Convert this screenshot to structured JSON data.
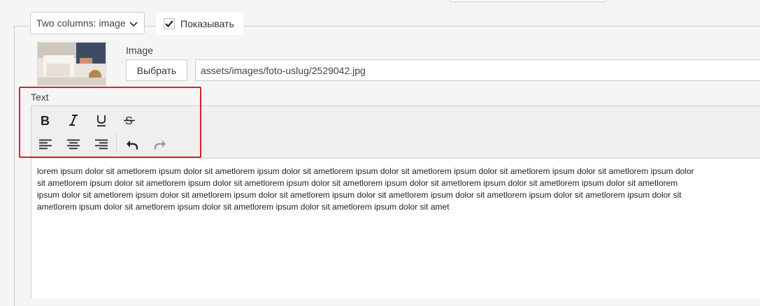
{
  "block": {
    "layout_select_value": "Two columns: image",
    "show_checkbox": {
      "label": "Показывать",
      "checked": true
    }
  },
  "image_field": {
    "label": "Image",
    "choose_label": "Выбрать",
    "path": "assets/images/foto-uslug/2529042.jpg"
  },
  "text_field": {
    "label": "Text",
    "toolbar": {
      "row1": [
        "bold-icon",
        "italic-icon",
        "underline-icon",
        "strikethrough-icon"
      ],
      "row2": [
        "align-left-icon",
        "align-center-icon",
        "align-right-icon",
        "undo-icon",
        "redo-icon"
      ]
    },
    "content_lines": [
      "lorem ipsum dolor sit ametlorem ipsum dolor sit ametlorem ipsum dolor sit ametlorem ipsum dolor sit ametlorem ipsum dolor sit ametlorem ipsum dolor sit ametlorem ipsum dolor",
      "sit ametlorem ipsum dolor sit ametlorem ipsum dolor sit ametlorem ipsum dolor sit ametlorem ipsum dolor sit ametlorem ipsum dolor sit ametlorem ipsum dolor sit ametlorem",
      "ipsum dolor sit ametlorem ipsum dolor sit ametlorem ipsum dolor sit ametlorem ipsum dolor sit ametlorem ipsum dolor sit ametlorem ipsum dolor sit ametlorem ipsum dolor sit",
      "ametlorem ipsum dolor sit ametlorem ipsum dolor sit ametlorem ipsum dolor sit ametlorem ipsum dolor sit amet"
    ]
  },
  "colors": {
    "highlight": "#d9232a",
    "toolbar_bg": "#efefef"
  }
}
